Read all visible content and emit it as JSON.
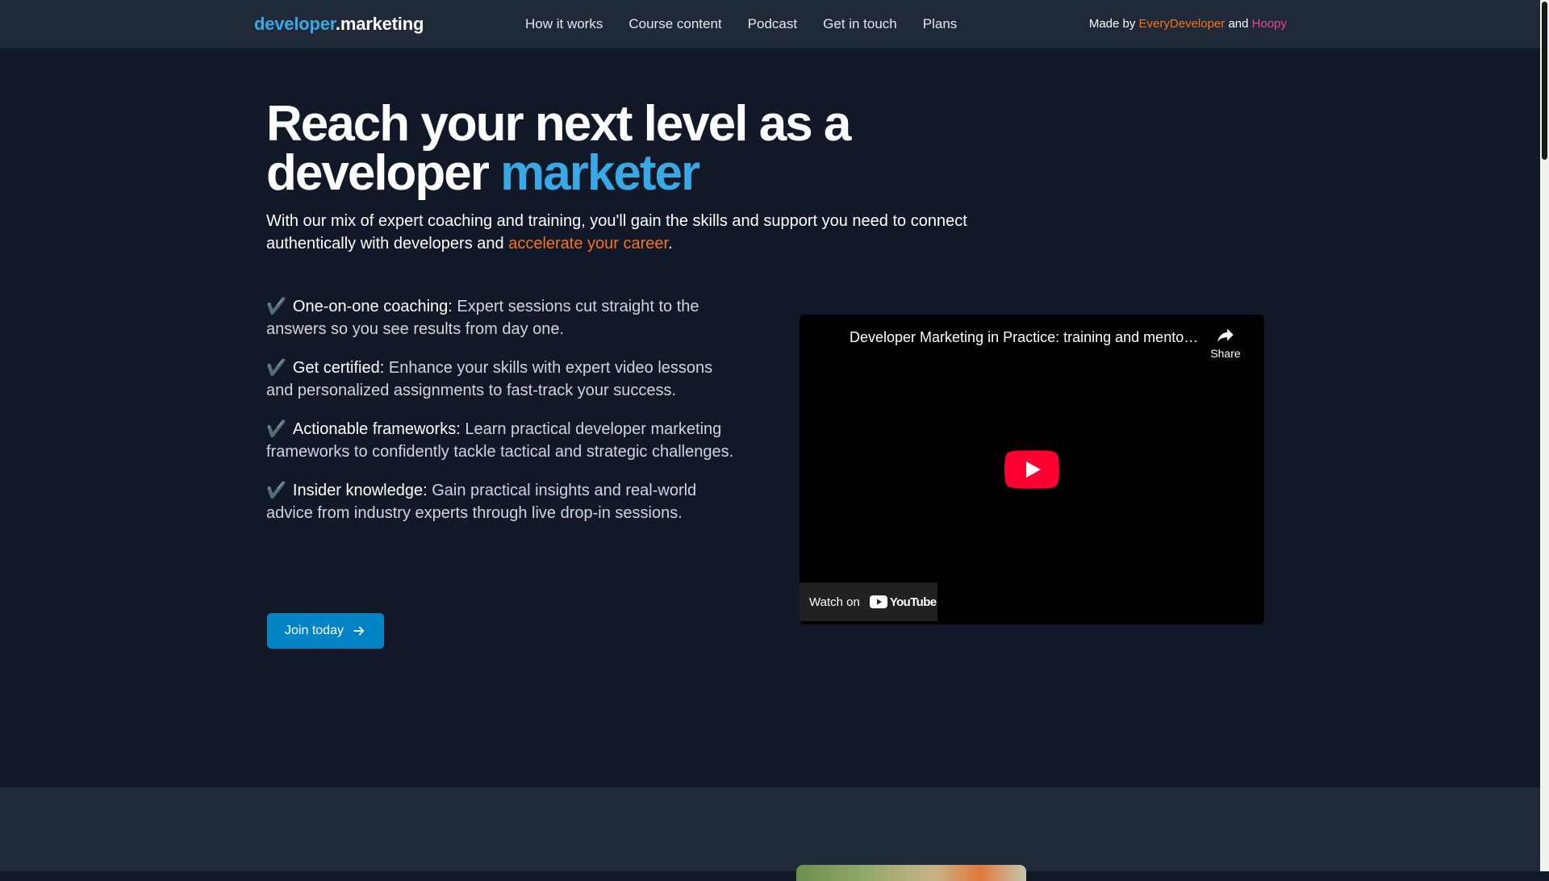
{
  "nav": {
    "logo_part1": "developer",
    "logo_part2": ".marketing",
    "items": [
      {
        "label": "How it works"
      },
      {
        "label": "Course content"
      },
      {
        "label": "Podcast"
      },
      {
        "label": "Get in touch"
      },
      {
        "label": "Plans"
      }
    ],
    "made_by_prefix": "Made by",
    "made_by_link1": "EveryDeveloper",
    "made_by_and": "and",
    "made_by_link2": "Hoopy"
  },
  "hero": {
    "headline_line1": "Reach your next level as a",
    "headline_line2_plain": "developer",
    "headline_line2_highlight": "marketer",
    "subhead_text": "With our mix of expert coaching and training, you'll gain the skills and support you need to connect authentically with developers and",
    "subhead_accent": "accelerate your career",
    "subhead_end": ".",
    "benefits": [
      {
        "check": "✔️",
        "title": "One-on-one coaching:",
        "text": "Expert sessions cut straight to the answers so you see results from day one."
      },
      {
        "check": "✔️",
        "title": "Get certified:",
        "text": "Enhance your skills with expert video lessons and personalized assignments to fast-track your success."
      },
      {
        "check": "✔️",
        "title": "Actionable frameworks:",
        "text": "Learn practical developer marketing frameworks to confidently tackle tactical and strategic challenges."
      },
      {
        "check": "✔️",
        "title": "Insider knowledge:",
        "text": "Gain practical insights and real-world advice from industry experts through live drop-in sessions."
      }
    ],
    "cta_label": "Join today"
  },
  "video": {
    "title": "Developer Marketing in Practice: training and mentoring",
    "share_label": "Share",
    "watch_on": "Watch on",
    "youtube_label": "YouTube"
  },
  "colors": {
    "page_bg": "#111827",
    "nav_bg": "#1f2937",
    "brand_blue": "#38a9e4",
    "accent_orange": "#f97316",
    "accent_pink": "#ec4899",
    "button_blue": "#0284c7",
    "youtube_red": "#ff0033"
  }
}
